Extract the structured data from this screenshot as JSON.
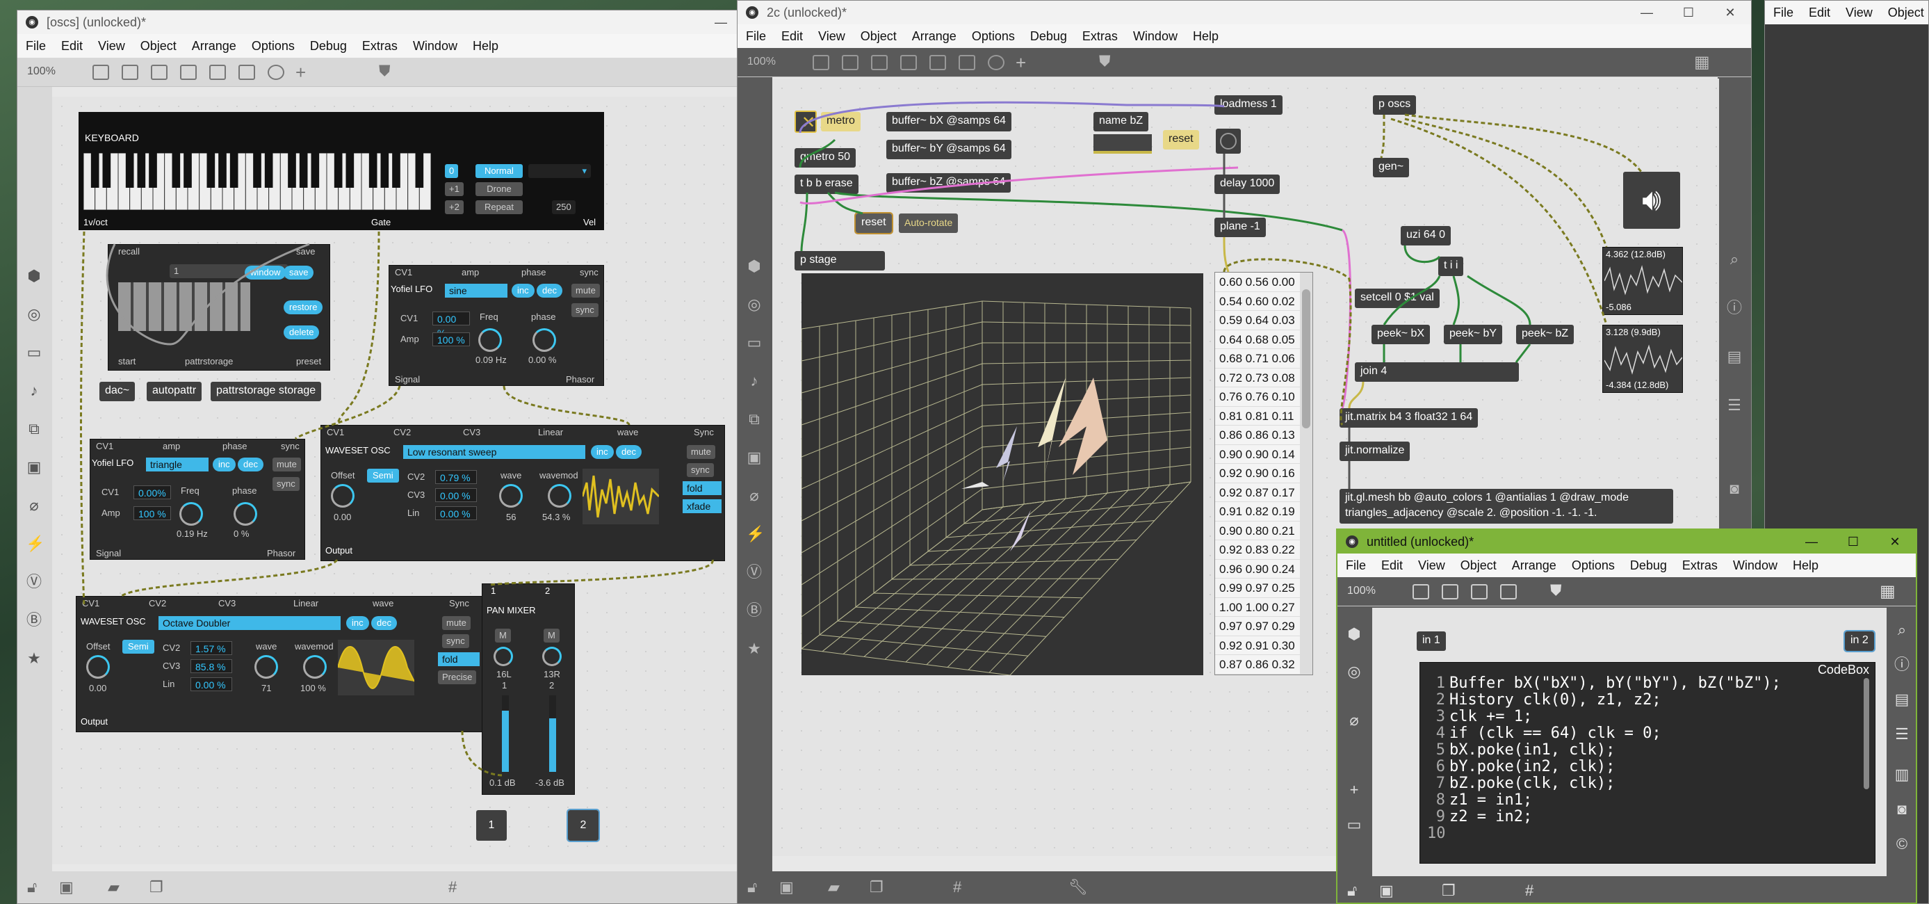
{
  "oscs_window": {
    "title": "[oscs] (unlocked)*",
    "menu": [
      "File",
      "Edit",
      "View",
      "Object",
      "Arrange",
      "Options",
      "Debug",
      "Extras",
      "Window",
      "Help"
    ],
    "zoom": "100%",
    "keyboard": {
      "title": "KEYBOARD",
      "octave": "0",
      "mode": "Normal",
      "plus1": "+1",
      "drone": "Drone",
      "plus2": "+2",
      "repeat": "Repeat",
      "value": "250",
      "out1": "1v/oct",
      "out2": "Gate",
      "out3": "Vel"
    },
    "pattr": {
      "recall": "recall",
      "save": "save",
      "slot": "1",
      "window": "window",
      "save2": "save",
      "restore": "restore",
      "delete": "delete",
      "start": "start",
      "mid": "pattrstorage",
      "preset": "preset"
    },
    "objects": {
      "dac": "dac~",
      "autopattr": "autopattr",
      "pattrstorage": "pattrstorage storage"
    },
    "lfo1": {
      "h1": "CV1",
      "h2": "amp",
      "h3": "phase",
      "h4": "sync",
      "name": "Yofiel LFO",
      "wave": "sine",
      "inc": "inc",
      "dec": "dec",
      "mute": "mute",
      "sync": "sync",
      "cv1_lbl": "CV1",
      "cv1": "0.00 %",
      "amp_lbl": "Amp",
      "amp": "100 %",
      "freq_lbl": "Freq",
      "freq": "0.09 Hz",
      "phase_lbl": "phase",
      "phase": "0.00 %",
      "out1": "Signal",
      "out2": "Phasor"
    },
    "lfo2": {
      "h1": "CV1",
      "h2": "amp",
      "h3": "phase",
      "h4": "sync",
      "name": "Yofiel LFO",
      "wave": "triangle",
      "inc": "inc",
      "dec": "dec",
      "mute": "mute",
      "sync": "sync",
      "cv1_lbl": "CV1",
      "cv1": "0.00%",
      "amp_lbl": "Amp",
      "amp": "100 %",
      "freq_lbl": "Freq",
      "freq": "0.19 Hz",
      "phase_lbl": "phase",
      "phase": "0 %",
      "out1": "Signal",
      "out2": "Phasor"
    },
    "osc1": {
      "h1": "CV1",
      "h2": "CV2",
      "h3": "CV3",
      "h4": "Linear",
      "h5": "wave",
      "h6": "Sync",
      "name": "WAVESET OSC",
      "preset": "Low resonant sweep",
      "inc": "inc",
      "dec": "dec",
      "offset_lbl": "Offset",
      "semi": "Semi",
      "offset": "0.00",
      "cv2_lbl": "CV2",
      "cv2": "0.79 %",
      "cv3_lbl": "CV3",
      "cv3": "0.00 %",
      "lin_lbl": "Lin",
      "lin": "0.00 %",
      "wave_lbl": "wave",
      "wave": "56",
      "wavemod_lbl": "wavemod",
      "wavemod": "54.3 %",
      "mute": "mute",
      "sync": "sync",
      "fold": "fold",
      "xfade": "xfade",
      "out": "Output"
    },
    "osc2": {
      "h1": "CV1",
      "h2": "CV2",
      "h3": "CV3",
      "h4": "Linear",
      "h5": "wave",
      "h6": "Sync",
      "name": "WAVESET OSC",
      "preset": "Octave Doubler",
      "inc": "inc",
      "dec": "dec",
      "offset_lbl": "Offset",
      "semi": "Semi",
      "offset": "0.00",
      "cv2_lbl": "CV2",
      "cv2": "1.57 %",
      "cv3_lbl": "CV3",
      "cv3": "85.8 %",
      "lin_lbl": "Lin",
      "lin": "0.00 %",
      "wave_lbl": "wave",
      "wave": "71",
      "wavemod_lbl": "wavemod",
      "wavemod": "100 %",
      "mute": "mute",
      "sync": "sync",
      "fold": "fold",
      "precise": "Precise",
      "out": "Output"
    },
    "panmixer": {
      "in1": "1",
      "in2": "2",
      "title": "PAN MIXER",
      "m1": "M",
      "m2": "M",
      "p1": "16L",
      "n1": "1",
      "p2": "13R",
      "n2": "2",
      "db1": "0.1 dB",
      "db2": "-3.6 dB",
      "out1": "1",
      "out2": "2"
    }
  },
  "main_window": {
    "title": "2c (unlocked)*",
    "menu": [
      "File",
      "Edit",
      "View",
      "Object",
      "Arrange",
      "Options",
      "Debug",
      "Extras",
      "Window",
      "Help"
    ],
    "zoom": "100%",
    "objects": {
      "metro": "metro",
      "qmetro": "qmetro 50",
      "tbb": "t b b erase",
      "reset_msg": "reset",
      "autorotate": "Auto-rotate",
      "pstage": "p stage",
      "bufx": "buffer~ bX @samps 64",
      "bufy": "buffer~ bY @samps 64",
      "bufz": "buffer~ bZ @samps 64",
      "namebz": "name bZ",
      "reset2": "reset",
      "loadmess": "loadmess 1",
      "delay": "delay 1000",
      "plane": "plane -1",
      "poscs": "p oscs",
      "gen": "gen~",
      "uzi": "uzi 64 0",
      "tii": "t i i",
      "setcell": "setcell 0 $1 val",
      "peekx": "peek~ bX",
      "peeky": "peek~ bY",
      "peekz": "peek~ bZ",
      "join": "join 4",
      "jitmatrix": "jit.matrix b4 3 float32 1 64",
      "jitnorm": "jit.normalize",
      "mesh": "jit.gl.mesh bb @auto_colors 1 @antialias 1 @draw_mode triangles_adjacency @scale 2. @position -1. -1. -1."
    },
    "scope1": {
      "top": "4.362 (12.8dB)",
      "bottom": "-5.086"
    },
    "scope2": {
      "top": "3.128 (9.9dB)",
      "bottom": "-4.384 (12.8dB)"
    },
    "matrix_rows": [
      "0.60 0.56 0.00",
      "0.54 0.60 0.02",
      "0.59 0.64 0.03",
      "0.64 0.68 0.05",
      "0.68 0.71 0.06",
      "0.72 0.73 0.08",
      "0.76 0.76 0.10",
      "0.81 0.81 0.11",
      "0.86 0.86 0.13",
      "0.90 0.90 0.14",
      "0.92 0.90 0.16",
      "0.92 0.87 0.17",
      "0.91 0.82 0.19",
      "0.90 0.80 0.21",
      "0.92 0.83 0.22",
      "0.96 0.90 0.24",
      "0.99 0.97 0.25",
      "1.00 1.00 0.27",
      "0.97 0.97 0.29",
      "0.92 0.91 0.30",
      "0.87 0.86 0.32"
    ]
  },
  "untitled_window": {
    "title": "untitled (unlocked)*",
    "menu": [
      "File",
      "Edit",
      "View",
      "Object",
      "Arrange",
      "Options",
      "Debug",
      "Extras",
      "Window",
      "Help"
    ],
    "zoom": "100%",
    "in1": "in 1",
    "in2": "in 2",
    "codebox_label": "CodeBox",
    "code_lines": [
      "Buffer bX(\"bX\"), bY(\"bY\"), bZ(\"bZ\");",
      "History clk(0), z1, z2;",
      "clk += 1;",
      "if (clk == 64) clk = 0;",
      "bX.poke(in1, clk);",
      "bY.poke(in2, clk);",
      "bZ.poke(clk, clk);",
      "z1 = in1;",
      "z2 = in2;",
      ""
    ],
    "line_numbers": [
      "1",
      "2",
      "3",
      "4",
      "5",
      "6",
      "7",
      "8",
      "9",
      "10"
    ]
  },
  "right_window": {
    "menu": [
      "File",
      "Edit",
      "View",
      "Object"
    ]
  },
  "colors": {
    "accent": "#3fb8e8",
    "patch_green": "#2d8a3a",
    "patch_pink": "#e070d0",
    "patch_purple": "#8a7ad0",
    "patch_yellow": "#c8b848",
    "window_green": "#7fb43a"
  }
}
